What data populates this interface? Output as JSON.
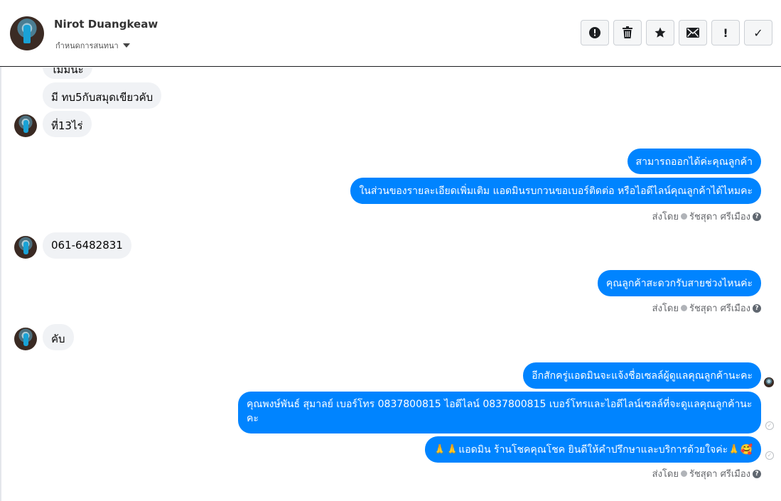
{
  "header": {
    "contact_name": "Nirot Duangkeaw",
    "subtitle": "กำหนดการสนทนา",
    "icons": [
      "alert-circle-icon",
      "trash-icon",
      "star-icon",
      "mail-icon",
      "exclamation-icon",
      "check-icon"
    ],
    "buttons": {
      "alert": "!",
      "important": "!",
      "done": "✓"
    }
  },
  "messages": {
    "m0": "ไม่มีนะ",
    "m1": "มี ทบ5กับสมุดเขียวคับ",
    "m2": "ที่13ไร่",
    "m3": "สามารถออกได้ค่ะคุณลูกค้า",
    "m4": "ในส่วนของรายละเอียดเพิ่มเติม แอดมินรบกวนขอเบอร์ติดต่อ หรือไอดีไลน์คุณลูกค้าได้ไหมคะ",
    "m5": "061-6482831",
    "m6": "คุณลูกค้าสะดวกรับสายช่วงไหนค่ะ",
    "m7": "คับ",
    "m8": "อีกสักครู่แอดมินจะแจ้งชื่อเซลล์ผู้ดูแลคุณลูกค้านะคะ",
    "m9": "คุณพงษ์พันธ์ สุมาลย์      เบอร์โทร 0837800815  ไอดีไลน์ 0837800815   เบอร์โทรและไอดีไลน์เซลล์ที่จะดูแลคุณลูกค้านะคะ",
    "m10": "🙏🙏แอดมิน ร้านโชคคุณโชค ยินดีให้คำปรึกษาและบริการด้วยใจค่ะ🙏🥰"
  },
  "meta": {
    "sent_by_label": "ส่งโดย",
    "sender": "รัชสุดา ศรีเมือง"
  }
}
